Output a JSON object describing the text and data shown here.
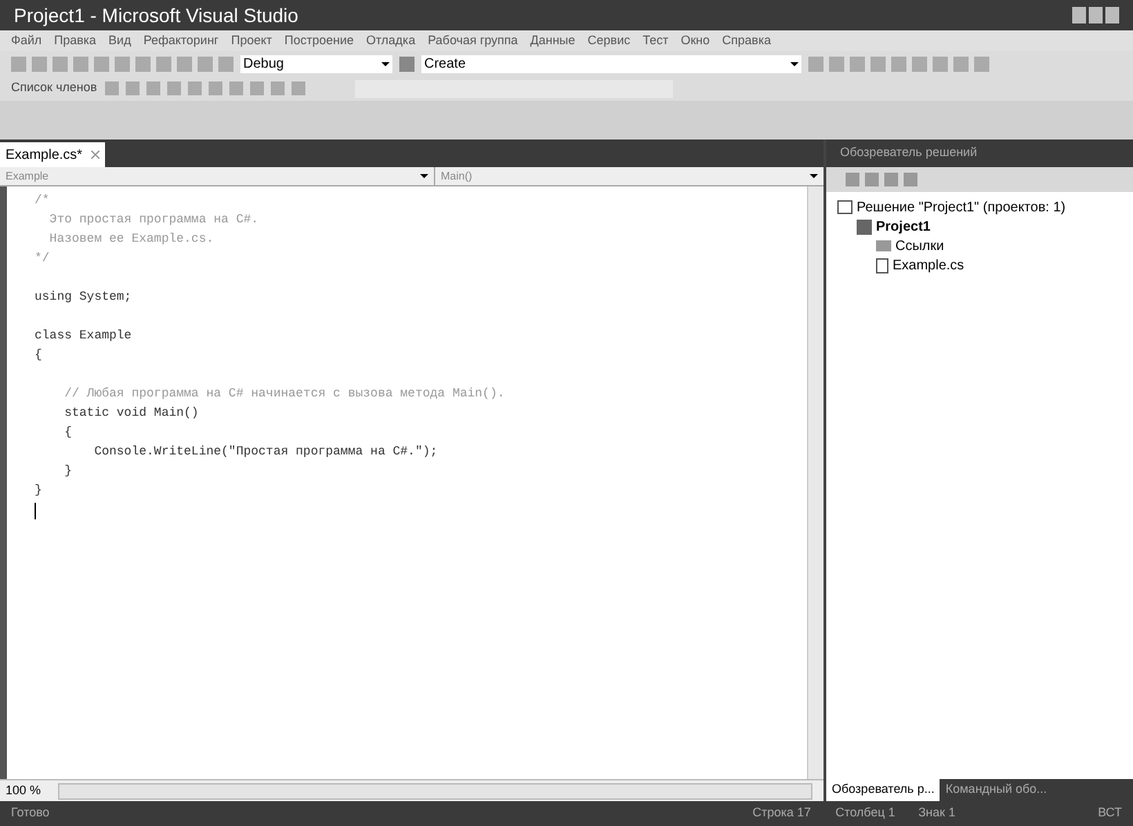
{
  "window": {
    "title": "Project1 - Microsoft Visual Studio"
  },
  "menu": [
    "Файл",
    "Правка",
    "Вид",
    "Рефакторинг",
    "Проект",
    "Построение",
    "Отладка",
    "Рабочая группа",
    "Данные",
    "Сервис",
    "Тест",
    "Окно",
    "Справка"
  ],
  "toolbar": {
    "configuration": "Debug",
    "search": "Create",
    "members_label": "Список членов"
  },
  "editor": {
    "tabs": [
      {
        "label": "Example.cs*",
        "selected": true
      }
    ],
    "type_dropdown": "Example",
    "member_dropdown": "Main()",
    "lines": [
      {
        "kind": "comment",
        "text": "/*"
      },
      {
        "kind": "comment",
        "text": "  Это простая программа на C#."
      },
      {
        "kind": "comment",
        "text": "  Назовем ее Example.cs."
      },
      {
        "kind": "comment",
        "text": "*/"
      },
      {
        "kind": "blank"
      },
      {
        "kind": "code",
        "text": "using System;"
      },
      {
        "kind": "blank"
      },
      {
        "kind": "code",
        "text": "class Example"
      },
      {
        "kind": "code",
        "text": "{"
      },
      {
        "kind": "blank"
      },
      {
        "kind": "comment",
        "text": "    // Любая программа на C# начинается с вызова метода Main()."
      },
      {
        "kind": "code",
        "text": "    static void Main()"
      },
      {
        "kind": "code",
        "text": "    {"
      },
      {
        "kind": "code",
        "text": "        Console.WriteLine(\"Простая программа на C#.\");"
      },
      {
        "kind": "code",
        "text": "    }"
      },
      {
        "kind": "code",
        "text": "}"
      },
      {
        "kind": "cursor"
      }
    ],
    "zoom": "100 %"
  },
  "solution_explorer": {
    "title": "Обозреватель решений",
    "tree": [
      {
        "label": "Решение \"Project1\"  (проектов: 1)",
        "kind": "solution",
        "children": [
          {
            "label": "Project1",
            "kind": "project",
            "children": [
              {
                "label": "Ссылки",
                "kind": "folder"
              },
              {
                "label": "Example.cs",
                "kind": "file"
              }
            ]
          }
        ]
      }
    ],
    "bottom_tabs": [
      {
        "label": "Обозреватель р...",
        "selected": true
      },
      {
        "label": "Командный обо...",
        "selected": false
      }
    ]
  },
  "status_bar": {
    "message": "Готово",
    "line": "Строка 17",
    "column": "Столбец 1",
    "char": "Знак 1",
    "mode": "ВСТ"
  }
}
